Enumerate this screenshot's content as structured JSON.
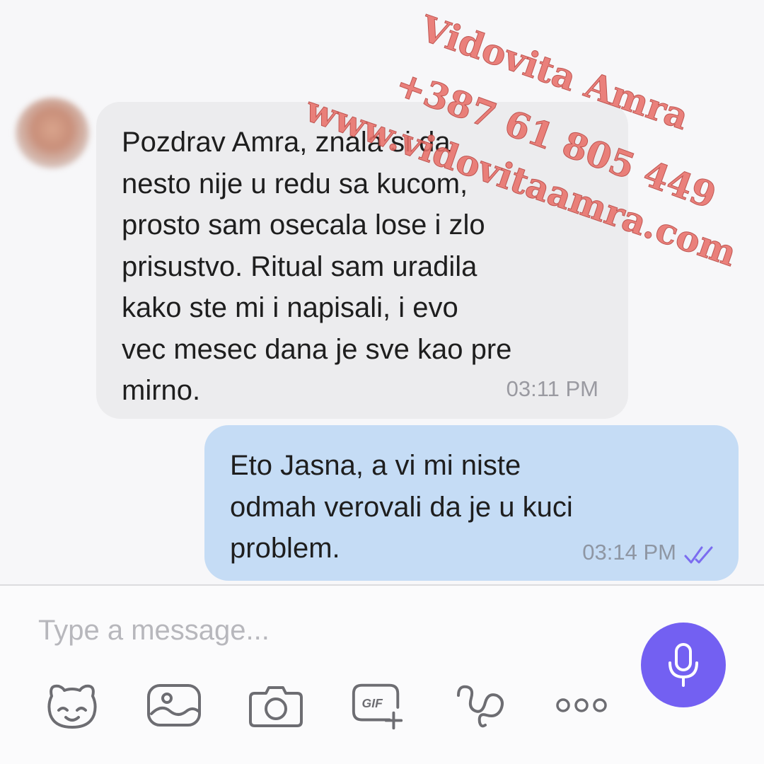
{
  "messages": {
    "incoming": {
      "text": "Pozdrav Amra, znala si da\nnesto nije u redu sa kucom,\nprosto sam osecala lose i zlo\nprisustvo. Ritual sam uradila\nkako ste mi i napisali, i evo\nvec mesec dana je sve kao pre\nmirno.",
      "time": "03:11 PM"
    },
    "outgoing": {
      "text": "Eto Jasna, a vi mi niste\nodmah verovali da je u kuci\nproblem.",
      "time": "03:14 PM",
      "status_icon": "double-check-icon"
    }
  },
  "composer": {
    "placeholder": "Type a message...",
    "tools": [
      "sticker-icon",
      "gallery-icon",
      "camera-icon",
      "gif-icon",
      "doodle-icon",
      "more-icon"
    ],
    "mic_icon": "microphone-icon",
    "gif_label": "GIF"
  },
  "watermark": {
    "line1": "Vidovita Amra",
    "line2": "+387 61 805 449",
    "line3": "www.vidovitaamra.com"
  },
  "colors": {
    "incoming_bubble": "#ececee",
    "outgoing_bubble": "#c5dcf5",
    "accent": "#7360f2",
    "watermark": "#e9706a"
  }
}
